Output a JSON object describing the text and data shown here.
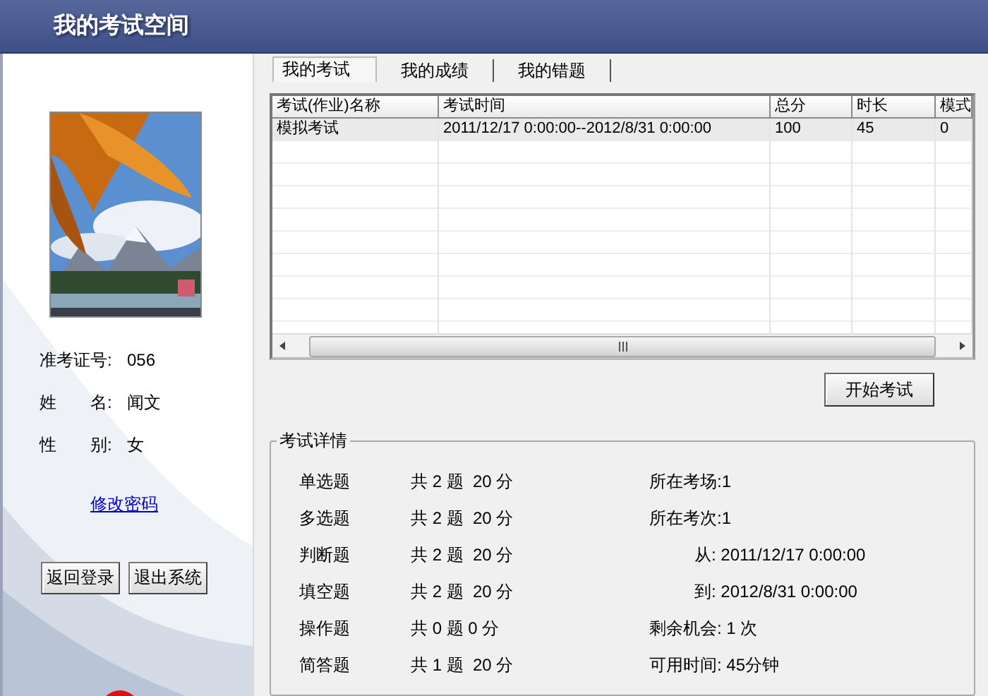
{
  "window": {
    "title": "我的考试空间"
  },
  "profile": {
    "fields": [
      {
        "label": "准考证号:",
        "value": "056"
      },
      {
        "label": "姓　　名:",
        "value": "闻文"
      },
      {
        "label": "性　　别:",
        "value": "女"
      }
    ],
    "link": "修改密码",
    "buttons": [
      "返回登录",
      "退出系统"
    ]
  },
  "tabs": [
    {
      "label": "我的考试",
      "selected": true
    },
    {
      "label": "我的成绩",
      "selected": false
    },
    {
      "label": "我的错题",
      "selected": false
    }
  ],
  "table": {
    "columns": [
      "考试(作业)名称",
      "考试时间",
      "总分",
      "时长",
      "模式"
    ],
    "rows": [
      [
        "模拟考试",
        "2011/12/17 0:00:00--2012/8/31 0:00:00",
        "100",
        "45",
        "0"
      ]
    ]
  },
  "start_button": "开始考试",
  "details": {
    "title": "考试详情",
    "question_types": [
      {
        "name": "单选题",
        "summary": "共 2 题  20 分"
      },
      {
        "name": "多选题",
        "summary": "共 2 题  20 分"
      },
      {
        "name": "判断题",
        "summary": "共 2 题  20 分"
      },
      {
        "name": "填空题",
        "summary": "共 2 题  20 分"
      },
      {
        "name": "操作题",
        "summary": "共 0 题 0 分"
      },
      {
        "name": "简答题",
        "summary": "共 1 题  20 分"
      }
    ],
    "info": [
      {
        "kind": "plain",
        "text": "所在考场:1"
      },
      {
        "kind": "plain",
        "text": "所在考次:1"
      },
      {
        "kind": "range",
        "text": "从: 2011/12/17 0:00:00"
      },
      {
        "kind": "range",
        "text": "到: 2012/8/31 0:00:00"
      },
      {
        "kind": "plain",
        "text": "剩余机会: 1 次"
      },
      {
        "kind": "plain",
        "text": "可用时间: 45分钟"
      }
    ]
  }
}
